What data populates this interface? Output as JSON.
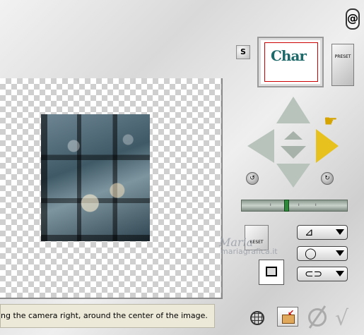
{
  "status_text": "ng the camera right, around the center of the image.",
  "preset_thumb_text": "Char",
  "preset_button_label": "PRESET",
  "s_button_label": "S",
  "reset_button_label": "RESET",
  "grip_label": "@",
  "slider": {
    "value_fraction": 0.42
  },
  "watermark": {
    "line1": "Maria",
    "line2": "mariagrafica.it"
  },
  "icons": {
    "toolbar_perspective": "grid-perspective-icon",
    "toolbar_rotate": "rotate-loop-icon",
    "toolbar_tilt": "tilt-loop-icon"
  },
  "colors": {
    "highlight_arrow": "#e7c21e",
    "arrow": "#b8c3bc"
  }
}
